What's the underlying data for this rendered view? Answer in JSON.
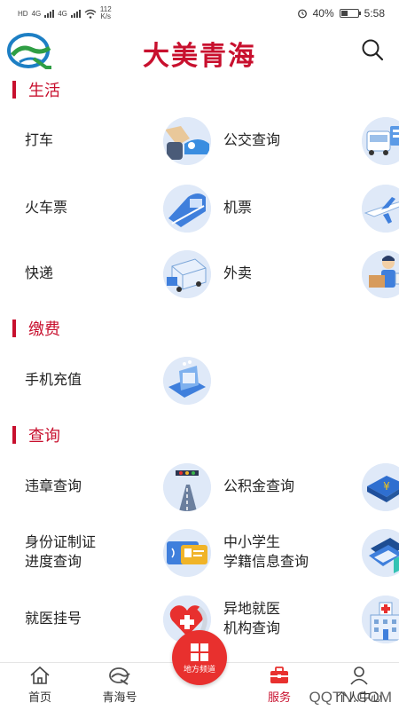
{
  "status_bar": {
    "net_left": "HD",
    "net_4g_1": "4G",
    "net_4g_2": "4G",
    "speed_value": "112",
    "speed_unit": "K/s",
    "battery": "40%",
    "battery_level": 0.4,
    "time": "5:58"
  },
  "header": {
    "title": "大美青海",
    "logo_icon": "qinghai-logo-icon",
    "search_icon": "search-icon"
  },
  "sections": [
    {
      "title": "生活",
      "items": [
        {
          "label": "打车",
          "icon": "taxi-icon"
        },
        {
          "label": "公交查询",
          "icon": "bus-icon"
        },
        {
          "label": "火车票",
          "icon": "train-icon"
        },
        {
          "label": "机票",
          "icon": "airplane-icon"
        },
        {
          "label": "快递",
          "icon": "delivery-truck-icon"
        },
        {
          "label": "外卖",
          "icon": "takeout-courier-icon"
        }
      ]
    },
    {
      "title": "缴费",
      "items": [
        {
          "label": "手机充值",
          "icon": "phone-topup-icon"
        }
      ]
    },
    {
      "title": "查询",
      "items": [
        {
          "label": "违章查询",
          "icon": "traffic-light-icon"
        },
        {
          "label": "公积金查询",
          "icon": "housing-fund-book-icon"
        },
        {
          "label": "身份证制证\n进度查询",
          "icon": "id-card-icon"
        },
        {
          "label": "中小学生\n学籍信息查询",
          "icon": "student-records-icon"
        },
        {
          "label": "就医挂号",
          "icon": "medical-heart-icon"
        },
        {
          "label": "异地就医\n机构查询",
          "icon": "hospital-building-icon"
        }
      ]
    }
  ],
  "bottom_nav": {
    "home": "首页",
    "qinghai": "青海号",
    "local_channel": "地方频道",
    "service": "服务",
    "mine": "个人中心"
  },
  "watermark": "QQTN.COM",
  "colors": {
    "brand_red": "#c8102e",
    "icon_bg": "#dfe9f8",
    "center_button": "#e8302e"
  }
}
